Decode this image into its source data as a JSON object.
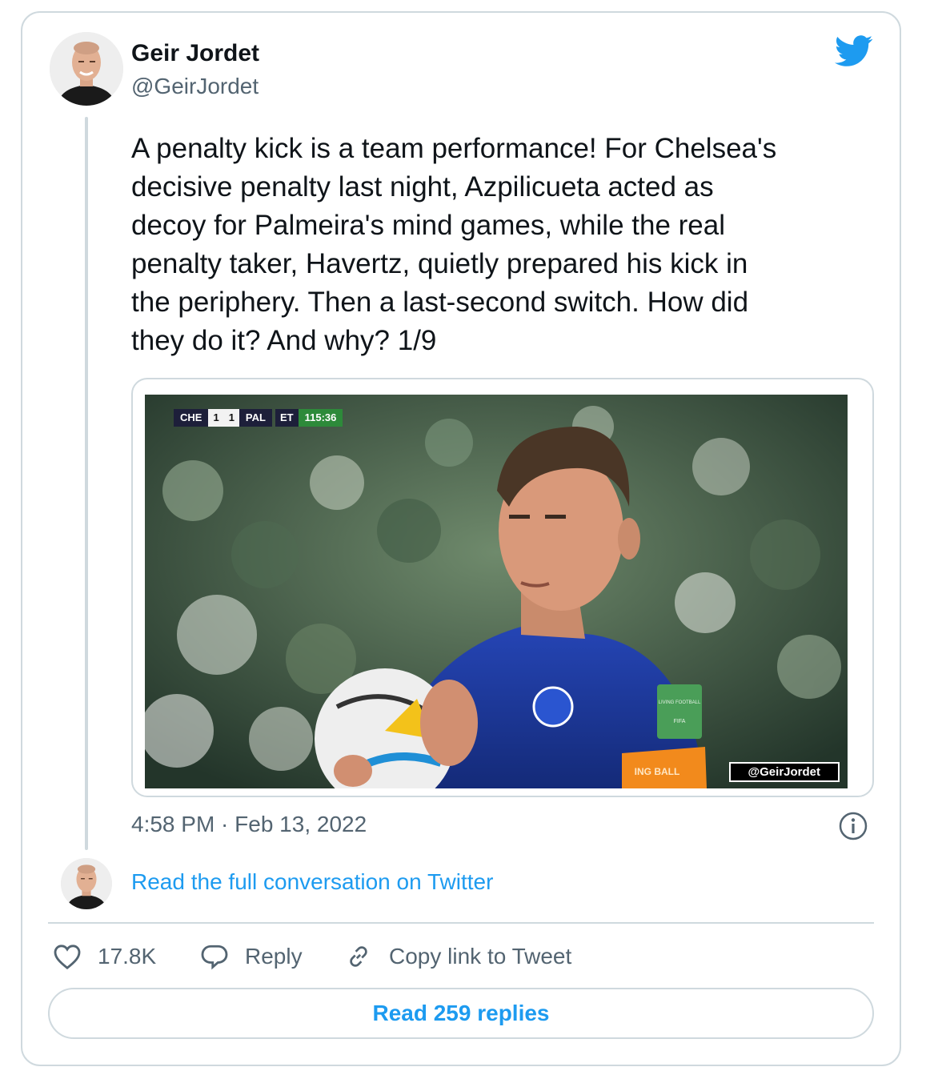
{
  "author": {
    "name": "Geir Jordet",
    "handle": "@GeirJordet"
  },
  "tweet": {
    "text": "A penalty kick is a team performance! For Chelsea's\ndecisive penalty last night, Azpilicueta acted as\ndecoy for Palmeira's mind games, while the real\npenalty taker, Havertz, quietly prepared his kick in\nthe periphery. Then a last-second switch. How did\nthey do it? And why? 1/9",
    "timestamp": "4:58 PM · Feb 13, 2022"
  },
  "media": {
    "scoreboard": {
      "home": "CHE",
      "home_score": "1",
      "away_score": "1",
      "away": "PAL",
      "period": "ET",
      "clock": "115:36"
    },
    "watermark": "@GeirJordet",
    "patch_text": "LIVING FOOTBALL",
    "patch_sub": "FIFA",
    "armband_text": "ING BALL"
  },
  "conversation_link": "Read the full conversation on Twitter",
  "actions": {
    "likes": "17.8K",
    "reply": "Reply",
    "copy_link": "Copy link to Tweet"
  },
  "read_replies": "Read 259 replies",
  "colors": {
    "link": "#1d9bf0",
    "secondary_text": "#536471",
    "border": "#cfd9de",
    "jersey": "#1e3fa3"
  },
  "icons": [
    "twitter-bird-icon",
    "info-icon",
    "heart-icon",
    "reply-icon",
    "link-icon"
  ]
}
